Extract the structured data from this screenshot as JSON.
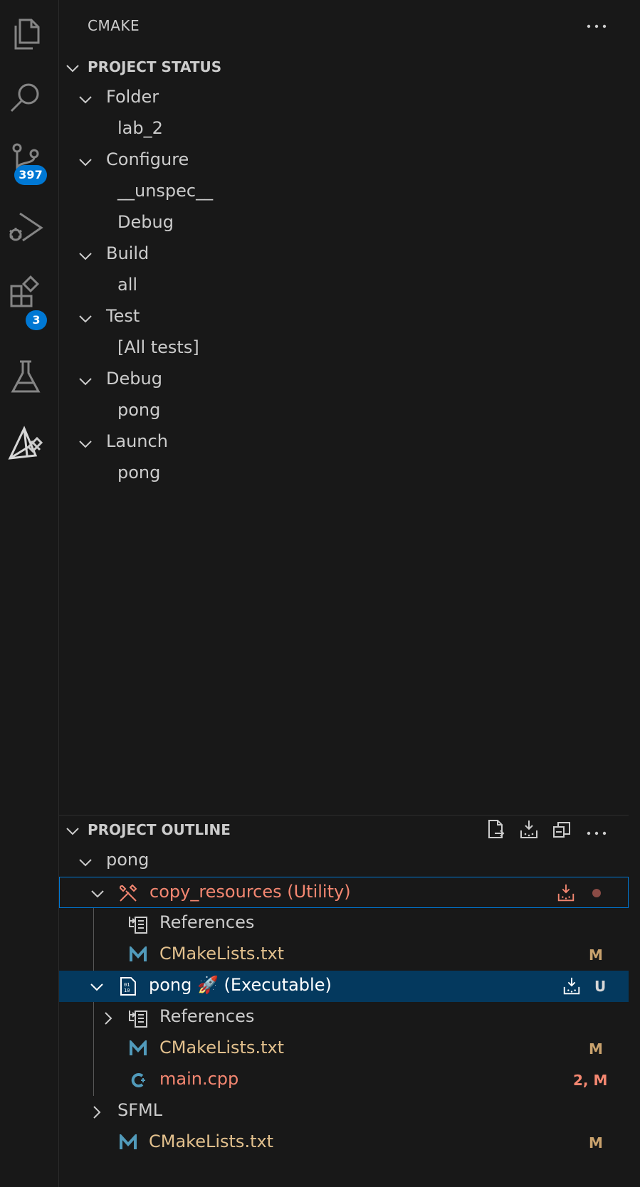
{
  "activity_bar": {
    "icons": [
      "explorer-icon",
      "search-icon",
      "source-control-icon",
      "run-debug-icon",
      "extensions-icon",
      "testing-icon",
      "cmake-icon"
    ],
    "source_control_badge": "397",
    "extensions_badge": "3"
  },
  "sidebar": {
    "title": "CMAKE",
    "more_label": "Views and More Actions"
  },
  "project_status": {
    "header": "PROJECT STATUS",
    "groups": [
      {
        "label": "Folder",
        "children": [
          "lab_2"
        ]
      },
      {
        "label": "Configure",
        "children": [
          "__unspec__",
          "Debug"
        ]
      },
      {
        "label": "Build",
        "children": [
          "all"
        ]
      },
      {
        "label": "Test",
        "children": [
          "[All tests]"
        ]
      },
      {
        "label": "Debug",
        "children": [
          "pong"
        ]
      },
      {
        "label": "Launch",
        "children": [
          "pong"
        ]
      }
    ]
  },
  "project_outline": {
    "header": "PROJECT OUTLINE",
    "root": "pong",
    "copy_resources": {
      "label": "copy_resources (Utility)",
      "references": "References",
      "cmakelists": "CMakeLists.txt",
      "cmakelists_status": "M"
    },
    "pong_target": {
      "label": "pong 🚀 (Executable)",
      "status": "U",
      "references": "References",
      "cmakelists": "CMakeLists.txt",
      "cmakelists_status": "M",
      "main": "main.cpp",
      "main_status": "2, M"
    },
    "sfml": "SFML",
    "root_cmakelists": "CMakeLists.txt",
    "root_cmakelists_status": "M"
  },
  "colors": {
    "accent": "#0078d4",
    "error_text": "#f48771",
    "modified_text": "#e2c08d",
    "modified_badge": "#c9a26d",
    "selected_bg": "#04395e"
  }
}
